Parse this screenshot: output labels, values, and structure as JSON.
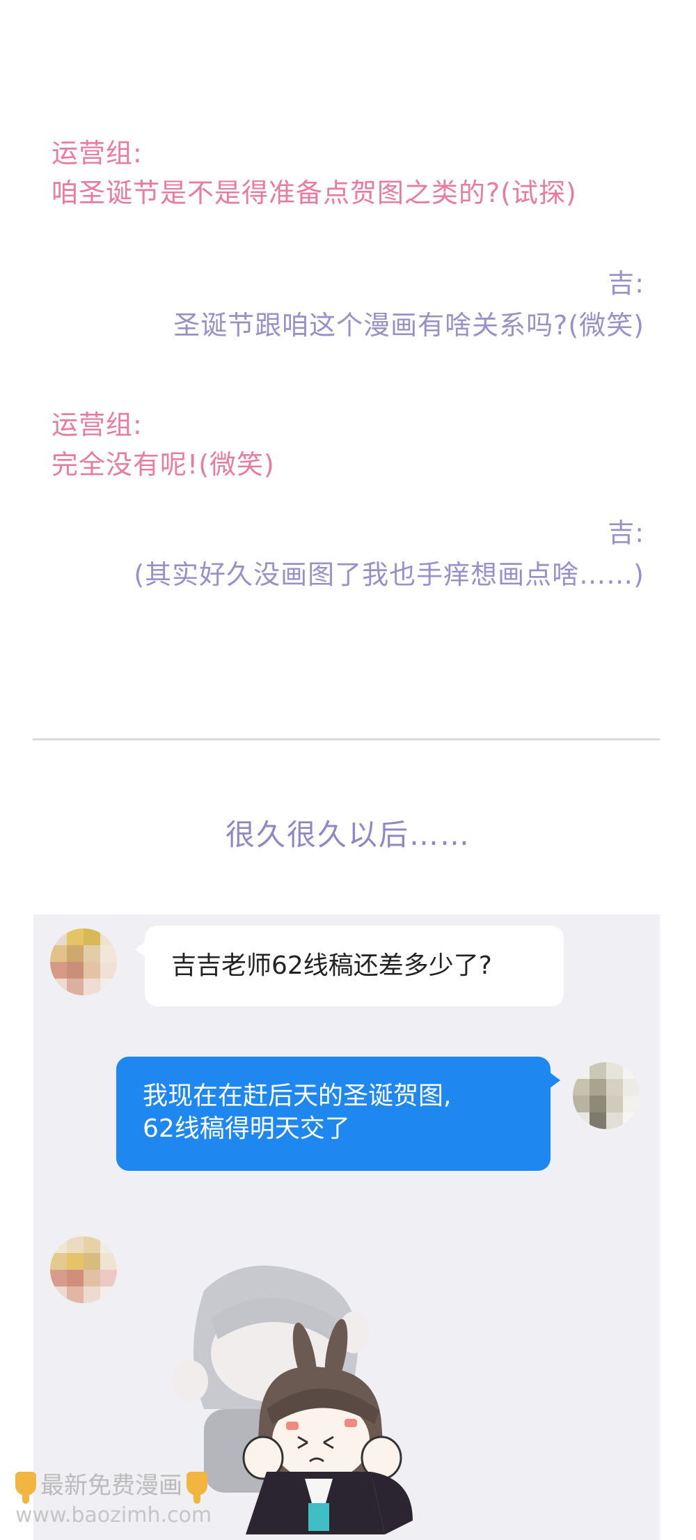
{
  "dialogue": [
    {
      "speaker": "运营组:",
      "line": "咱圣诞节是不是得准备点贺图之类的?(试探)"
    },
    {
      "speaker": "吉:",
      "line": "圣诞节跟咱这个漫画有啥关系吗?(微笑)"
    },
    {
      "speaker": "运营组:",
      "line": "完全没有呢!(微笑)"
    },
    {
      "speaker": "吉:",
      "line": "(其实好久没画图了我也手痒想画点啥……)"
    }
  ],
  "transition": "很久很久以后……",
  "chat": {
    "message_left": "吉吉老师62线稿还差多少了?",
    "message_right": [
      "我现在在赶后天的圣诞贺图,",
      "62线稿得明天交了"
    ]
  },
  "watermark": {
    "title": "最新免费漫画",
    "url": "www.baozimh.com"
  },
  "colors": {
    "pink": "#e97aa0",
    "purple": "#9a90c9",
    "chat_bg": "#efeff4",
    "blue_bubble": "#1e87f0"
  },
  "icons": [
    "pointing-down-hand-icon",
    "pixelated-avatar",
    "chibi-sticker"
  ]
}
